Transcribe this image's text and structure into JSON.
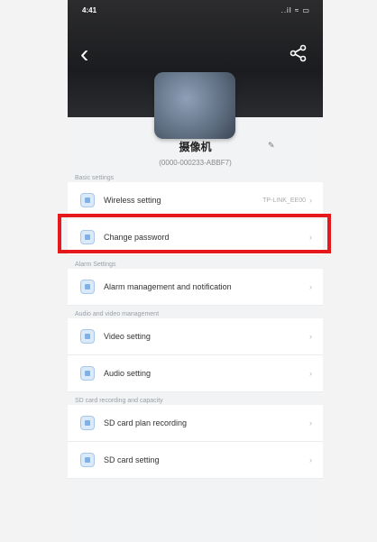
{
  "status_bar": {
    "time": "4:41",
    "icons": "..il ≈ ▭"
  },
  "header": {
    "back_icon": "chevron-left-icon",
    "share_icon": "share-icon"
  },
  "device": {
    "name": "摄像机",
    "id": "(0000-000233-ABBF7)"
  },
  "sections": [
    {
      "title": "Basic settings",
      "rows": [
        {
          "label": "Wireless setting",
          "value": "TP-LINK_EE00",
          "icon": "wifi-icon"
        },
        {
          "label": "Change password",
          "value": "",
          "icon": "lock-icon"
        }
      ]
    },
    {
      "title": "Alarm Settings",
      "rows": [
        {
          "label": "Alarm management and notification",
          "value": "",
          "icon": "alarm-icon"
        }
      ]
    },
    {
      "title": "Audio and video management",
      "rows": [
        {
          "label": "Video setting",
          "value": "",
          "icon": "video-icon"
        },
        {
          "label": "Audio setting",
          "value": "",
          "icon": "audio-icon"
        }
      ]
    },
    {
      "title": "SD card recording and capacity",
      "rows": [
        {
          "label": "SD card plan recording",
          "value": "",
          "icon": "sd-card-icon"
        },
        {
          "label": "SD card setting",
          "value": "",
          "icon": "sd-card-settings-icon"
        }
      ]
    }
  ],
  "colors": {
    "highlight": "#e5191c",
    "header_bg": "#1d1e21",
    "page_bg": "#f2f3f5"
  }
}
